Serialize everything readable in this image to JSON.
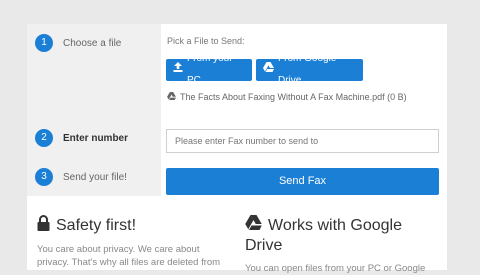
{
  "steps": [
    {
      "num": "1",
      "label": "Choose a file"
    },
    {
      "num": "2",
      "label": "Enter number"
    },
    {
      "num": "3",
      "label": "Send your file!"
    }
  ],
  "picker": {
    "label": "Pick a File to Send:",
    "pc_button": "From your PC",
    "drive_button": "From Google Drive",
    "file_name": "The Facts About Faxing Without A Fax Machine.pdf (0 B)"
  },
  "fax": {
    "placeholder": "Please enter Fax number to send to",
    "send_button": "Send Fax"
  },
  "safety": {
    "title": "Safety first!",
    "text_line1": "You care about privacy. We care about",
    "text_line2": "privacy. That's why all files are deleted from"
  },
  "drive": {
    "title_line1": "Works with Google",
    "title_line2": "Drive",
    "text_line1": "You can open files from your PC or Google"
  },
  "colors": {
    "accent": "#1c7fd6"
  }
}
